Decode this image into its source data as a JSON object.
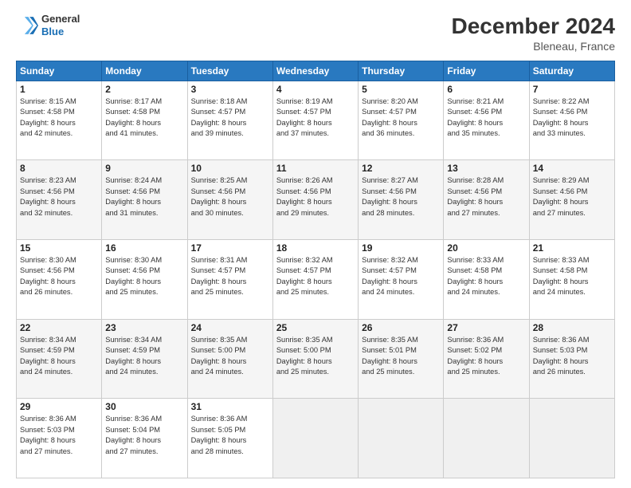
{
  "logo": {
    "line1": "General",
    "line2": "Blue"
  },
  "title": "December 2024",
  "subtitle": "Bleneau, France",
  "header_days": [
    "Sunday",
    "Monday",
    "Tuesday",
    "Wednesday",
    "Thursday",
    "Friday",
    "Saturday"
  ],
  "weeks": [
    [
      {
        "day": "1",
        "info": "Sunrise: 8:15 AM\nSunset: 4:58 PM\nDaylight: 8 hours\nand 42 minutes."
      },
      {
        "day": "2",
        "info": "Sunrise: 8:17 AM\nSunset: 4:58 PM\nDaylight: 8 hours\nand 41 minutes."
      },
      {
        "day": "3",
        "info": "Sunrise: 8:18 AM\nSunset: 4:57 PM\nDaylight: 8 hours\nand 39 minutes."
      },
      {
        "day": "4",
        "info": "Sunrise: 8:19 AM\nSunset: 4:57 PM\nDaylight: 8 hours\nand 37 minutes."
      },
      {
        "day": "5",
        "info": "Sunrise: 8:20 AM\nSunset: 4:57 PM\nDaylight: 8 hours\nand 36 minutes."
      },
      {
        "day": "6",
        "info": "Sunrise: 8:21 AM\nSunset: 4:56 PM\nDaylight: 8 hours\nand 35 minutes."
      },
      {
        "day": "7",
        "info": "Sunrise: 8:22 AM\nSunset: 4:56 PM\nDaylight: 8 hours\nand 33 minutes."
      }
    ],
    [
      {
        "day": "8",
        "info": "Sunrise: 8:23 AM\nSunset: 4:56 PM\nDaylight: 8 hours\nand 32 minutes."
      },
      {
        "day": "9",
        "info": "Sunrise: 8:24 AM\nSunset: 4:56 PM\nDaylight: 8 hours\nand 31 minutes."
      },
      {
        "day": "10",
        "info": "Sunrise: 8:25 AM\nSunset: 4:56 PM\nDaylight: 8 hours\nand 30 minutes."
      },
      {
        "day": "11",
        "info": "Sunrise: 8:26 AM\nSunset: 4:56 PM\nDaylight: 8 hours\nand 29 minutes."
      },
      {
        "day": "12",
        "info": "Sunrise: 8:27 AM\nSunset: 4:56 PM\nDaylight: 8 hours\nand 28 minutes."
      },
      {
        "day": "13",
        "info": "Sunrise: 8:28 AM\nSunset: 4:56 PM\nDaylight: 8 hours\nand 27 minutes."
      },
      {
        "day": "14",
        "info": "Sunrise: 8:29 AM\nSunset: 4:56 PM\nDaylight: 8 hours\nand 27 minutes."
      }
    ],
    [
      {
        "day": "15",
        "info": "Sunrise: 8:30 AM\nSunset: 4:56 PM\nDaylight: 8 hours\nand 26 minutes."
      },
      {
        "day": "16",
        "info": "Sunrise: 8:30 AM\nSunset: 4:56 PM\nDaylight: 8 hours\nand 25 minutes."
      },
      {
        "day": "17",
        "info": "Sunrise: 8:31 AM\nSunset: 4:57 PM\nDaylight: 8 hours\nand 25 minutes."
      },
      {
        "day": "18",
        "info": "Sunrise: 8:32 AM\nSunset: 4:57 PM\nDaylight: 8 hours\nand 25 minutes."
      },
      {
        "day": "19",
        "info": "Sunrise: 8:32 AM\nSunset: 4:57 PM\nDaylight: 8 hours\nand 24 minutes."
      },
      {
        "day": "20",
        "info": "Sunrise: 8:33 AM\nSunset: 4:58 PM\nDaylight: 8 hours\nand 24 minutes."
      },
      {
        "day": "21",
        "info": "Sunrise: 8:33 AM\nSunset: 4:58 PM\nDaylight: 8 hours\nand 24 minutes."
      }
    ],
    [
      {
        "day": "22",
        "info": "Sunrise: 8:34 AM\nSunset: 4:59 PM\nDaylight: 8 hours\nand 24 minutes."
      },
      {
        "day": "23",
        "info": "Sunrise: 8:34 AM\nSunset: 4:59 PM\nDaylight: 8 hours\nand 24 minutes."
      },
      {
        "day": "24",
        "info": "Sunrise: 8:35 AM\nSunset: 5:00 PM\nDaylight: 8 hours\nand 24 minutes."
      },
      {
        "day": "25",
        "info": "Sunrise: 8:35 AM\nSunset: 5:00 PM\nDaylight: 8 hours\nand 25 minutes."
      },
      {
        "day": "26",
        "info": "Sunrise: 8:35 AM\nSunset: 5:01 PM\nDaylight: 8 hours\nand 25 minutes."
      },
      {
        "day": "27",
        "info": "Sunrise: 8:36 AM\nSunset: 5:02 PM\nDaylight: 8 hours\nand 25 minutes."
      },
      {
        "day": "28",
        "info": "Sunrise: 8:36 AM\nSunset: 5:03 PM\nDaylight: 8 hours\nand 26 minutes."
      }
    ],
    [
      {
        "day": "29",
        "info": "Sunrise: 8:36 AM\nSunset: 5:03 PM\nDaylight: 8 hours\nand 27 minutes."
      },
      {
        "day": "30",
        "info": "Sunrise: 8:36 AM\nSunset: 5:04 PM\nDaylight: 8 hours\nand 27 minutes."
      },
      {
        "day": "31",
        "info": "Sunrise: 8:36 AM\nSunset: 5:05 PM\nDaylight: 8 hours\nand 28 minutes."
      },
      {
        "day": "",
        "info": ""
      },
      {
        "day": "",
        "info": ""
      },
      {
        "day": "",
        "info": ""
      },
      {
        "day": "",
        "info": ""
      }
    ]
  ],
  "colors": {
    "header_bg": "#2979c0",
    "accent": "#1a6fb5"
  }
}
